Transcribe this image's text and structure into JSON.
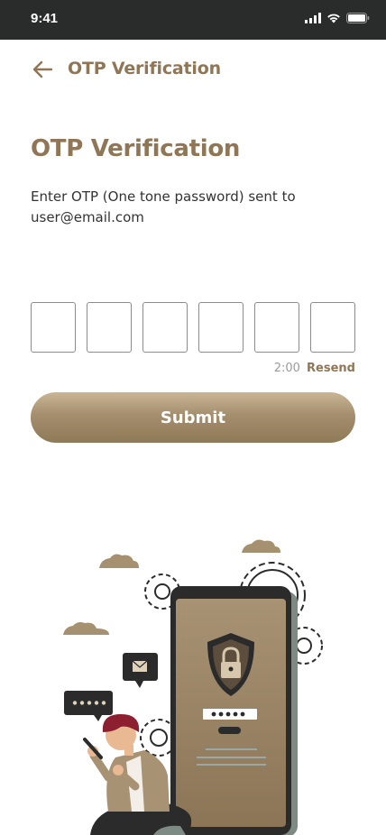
{
  "status_bar": {
    "time": "9:41"
  },
  "header": {
    "title": "OTP Verification"
  },
  "main": {
    "title": "OTP Verification",
    "description": "Enter OTP (One tone password) sent to user@email.com",
    "otp_fields": [
      "",
      "",
      "",
      "",
      "",
      ""
    ],
    "timer": "2:00",
    "resend_label": "Resend",
    "submit_label": "Submit"
  },
  "colors": {
    "accent": "#8f7657",
    "status_bar_bg": "#2a2c2b",
    "button_gradient_top": "#c9b595",
    "button_gradient_bottom": "#8f7a58"
  },
  "icons": {
    "back": "arrow-left-icon",
    "signal": "signal-icon",
    "wifi": "wifi-icon",
    "battery": "battery-icon"
  }
}
